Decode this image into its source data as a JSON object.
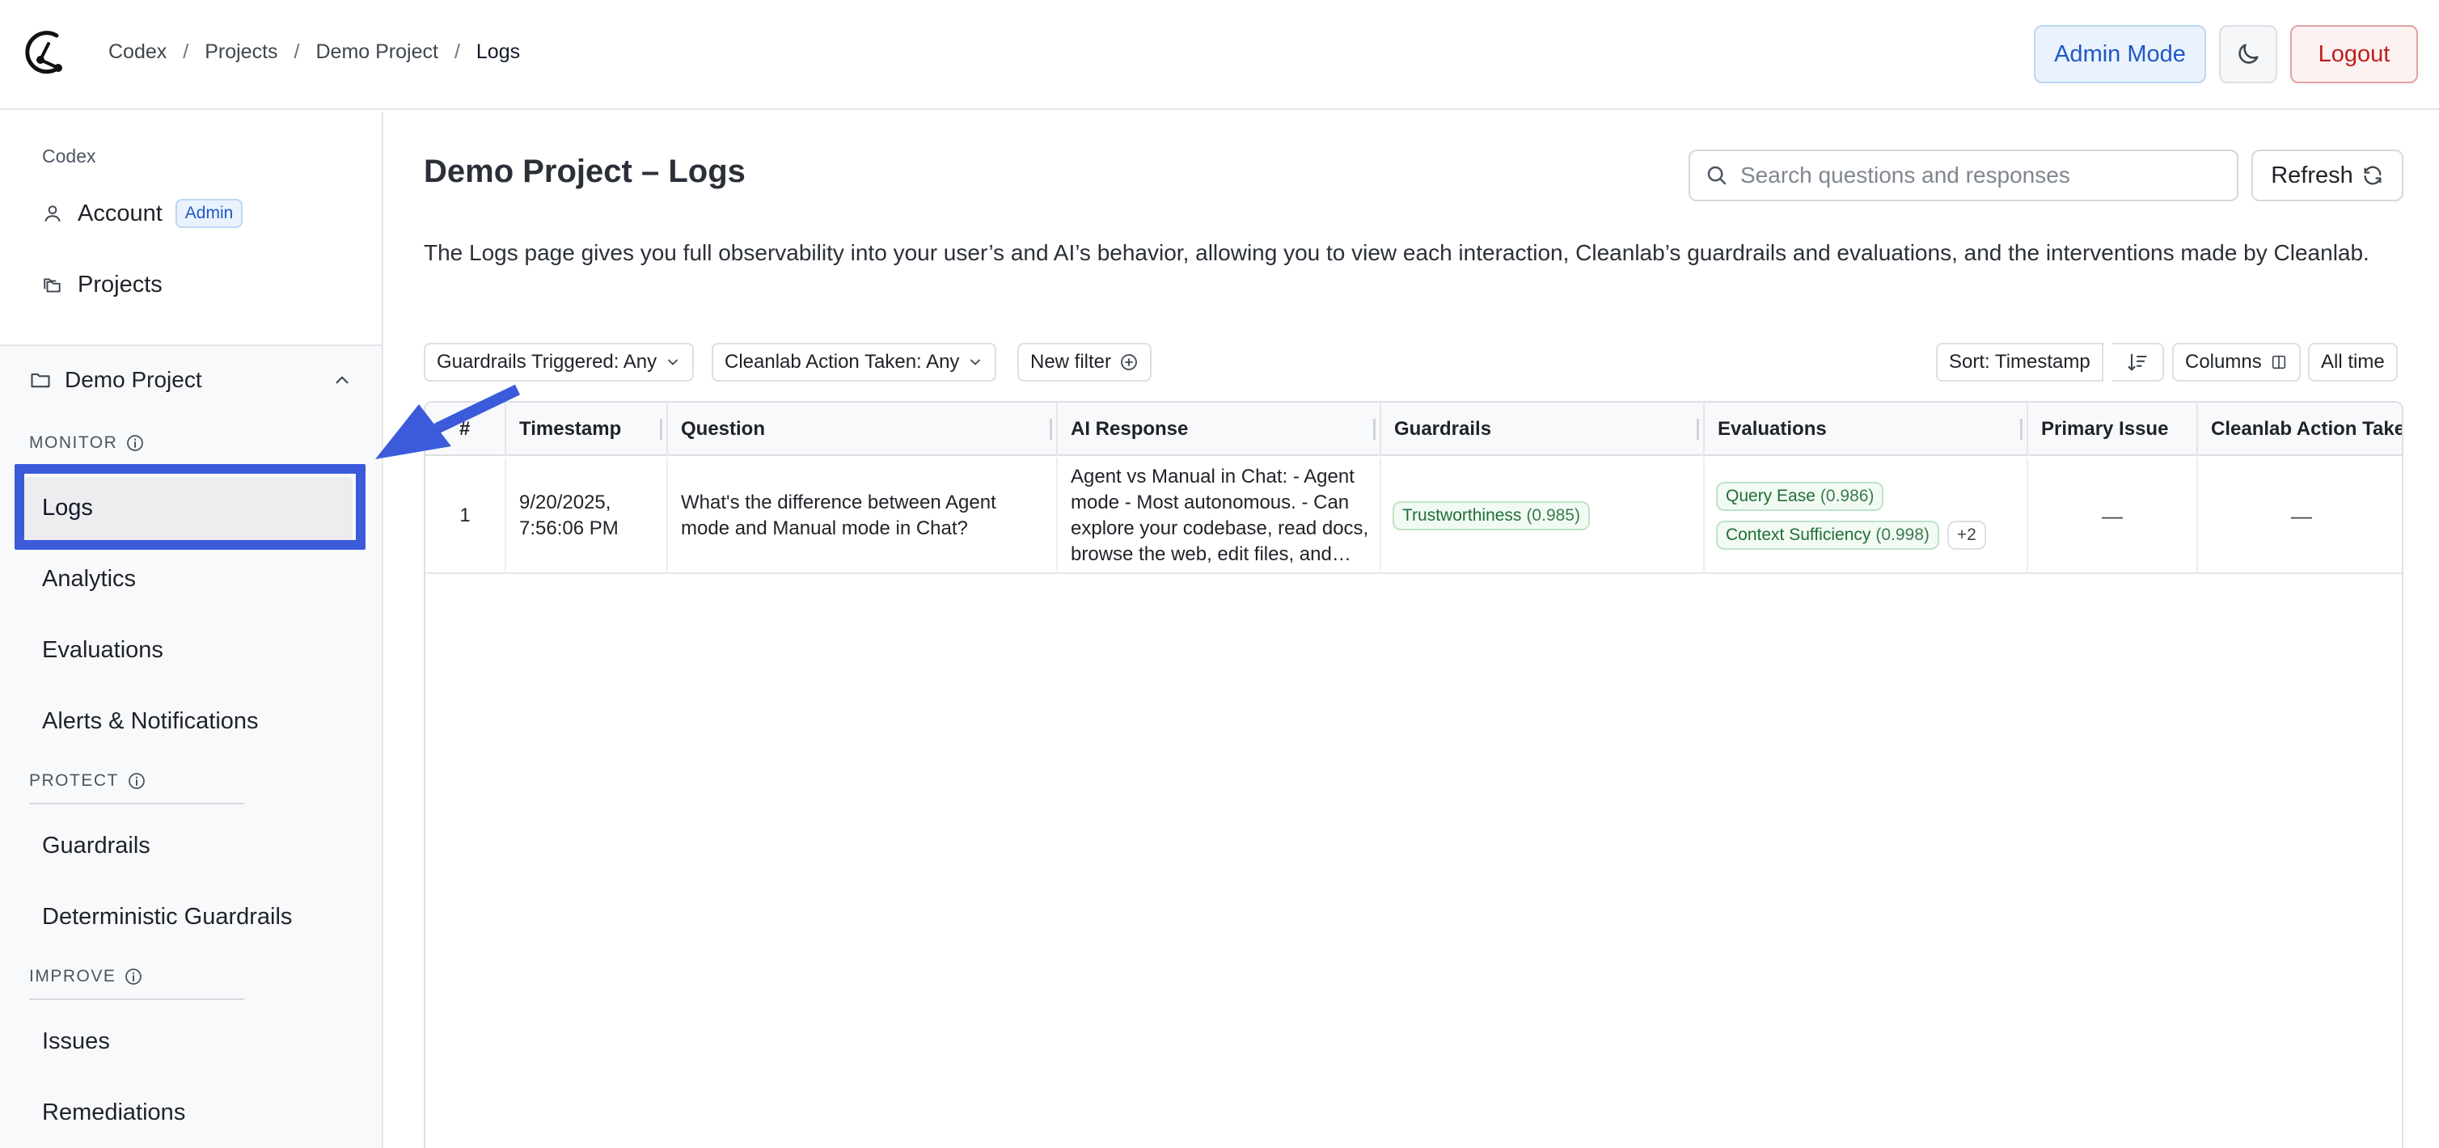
{
  "header": {
    "breadcrumb": [
      "Codex",
      "Projects",
      "Demo Project",
      "Logs"
    ],
    "admin_mode_label": "Admin Mode",
    "logout_label": "Logout"
  },
  "sidebar": {
    "org_label": "Codex",
    "account_label": "Account",
    "admin_badge": "Admin",
    "projects_label": "Projects",
    "project_name": "Demo Project",
    "groups": {
      "monitor": "MONITOR",
      "protect": "PROTECT",
      "improve": "IMPROVE"
    },
    "monitor_items": [
      "Logs",
      "Analytics",
      "Evaluations",
      "Alerts & Notifications"
    ],
    "protect_items": [
      "Guardrails",
      "Deterministic Guardrails"
    ],
    "improve_items": [
      "Issues",
      "Remediations"
    ],
    "active_item": "Logs"
  },
  "main": {
    "title": "Demo Project – Logs",
    "search_placeholder": "Search questions and responses",
    "refresh_label": "Refresh",
    "intro": "The Logs page gives you full observability into your user’s and AI’s behavior, allowing you to view each interaction, Cleanlab’s guardrails and evaluations, and the interventions made by Cleanlab.",
    "filters": {
      "guardrails": "Guardrails Triggered: Any",
      "action": "Cleanlab Action Taken: Any",
      "new_filter": "New filter"
    },
    "sort_label": "Sort: Timestamp",
    "columns_label": "Columns",
    "time_range": "All time"
  },
  "table": {
    "columns": [
      "#",
      "Timestamp",
      "Question",
      "AI Response",
      "Guardrails",
      "Evaluations",
      "Primary Issue",
      "Cleanlab Action Take"
    ],
    "rows": [
      {
        "index": "1",
        "timestamp": "9/20/2025, 7:56:06 PM",
        "question": "What's the difference between Agent mode and Manual mode in Chat?",
        "response": "Agent vs Manual in Chat: - Agent mode - Most autonomous. - Can explore your codebase, read docs, browse the web, edit files, and more.",
        "guardrail": {
          "name": "Trustworthiness",
          "score": "(0.985)"
        },
        "evaluations": [
          {
            "name": "Query Ease",
            "score": "(0.986)"
          },
          {
            "name": "Context Sufficiency",
            "score": "(0.998)"
          }
        ],
        "evaluations_more": "+2",
        "primary_issue": "—",
        "action": "—"
      }
    ]
  },
  "colors": {
    "accent": "#1f57c7",
    "annotation": "#3b5bdb",
    "logout": "#c01f1f",
    "pass_pill": "#1f6e34"
  }
}
